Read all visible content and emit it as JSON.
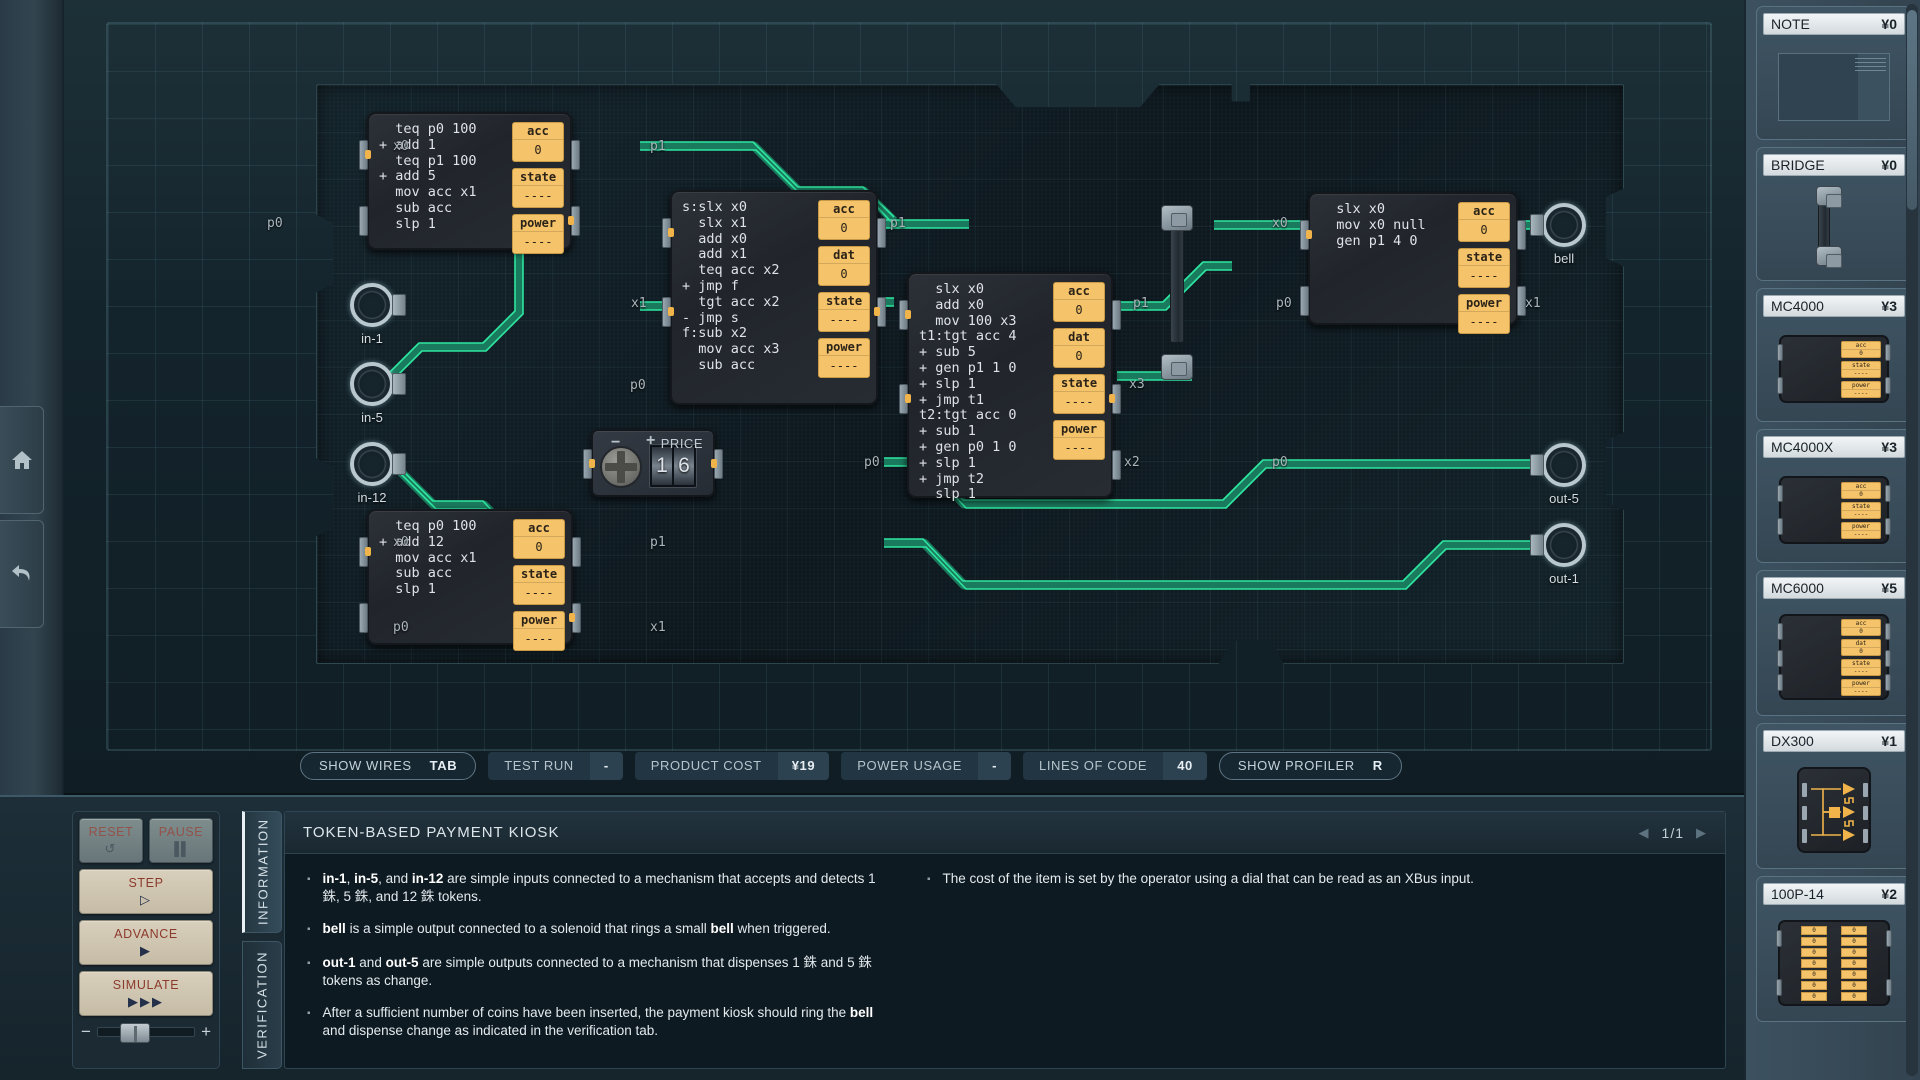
{
  "toolbar": {
    "show_wires": {
      "label": "SHOW WIRES",
      "key": "TAB"
    },
    "test_run": {
      "label": "TEST RUN",
      "value": "-"
    },
    "product_cost": {
      "label": "PRODUCT COST",
      "value": "¥19"
    },
    "power_usage": {
      "label": "POWER USAGE",
      "value": "-"
    },
    "lines_of_code": {
      "label": "LINES OF CODE",
      "value": "40"
    },
    "show_profiler": {
      "label": "SHOW PROFILER",
      "key": "R"
    }
  },
  "sim": {
    "reset": {
      "label": "RESET",
      "glyph": "↺"
    },
    "pause": {
      "label": "PAUSE",
      "glyph": "▐▌"
    },
    "step": {
      "label": "STEP",
      "glyph": "▷"
    },
    "advance": {
      "label": "ADVANCE",
      "glyph": "▶"
    },
    "simulate": {
      "label": "SIMULATE",
      "glyph": "▶▶▶"
    },
    "speed_minus": "−",
    "speed_plus": "+"
  },
  "tabs": [
    {
      "label": "INFORMATION",
      "selected": true
    },
    {
      "label": "VERIFICATION",
      "selected": false
    }
  ],
  "info": {
    "title": "TOKEN-BASED PAYMENT KIOSK",
    "page": "1/1",
    "prev_arrow": "◀",
    "next_arrow": "▶",
    "left_bullets": [
      "in-1, in-5, and in-12 are simple inputs connected to a mechanism that accepts and detects 1 銖, 5 銖, and 12 銖 tokens.",
      "bell is a simple output connected to a solenoid that rings a small bell when triggered.",
      "out-1 and out-5 are simple outputs connected to a mechanism that dispenses 1 銖 and 5 銖 tokens as change.",
      "After a sufficient number of coins have been inserted, the payment kiosk should ring the bell and dispense change as indicated in the verification tab."
    ],
    "right_bullets": [
      "The cost of the item is set by the operator using a dial that can be read as an XBus input."
    ]
  },
  "parts": [
    {
      "name": "NOTE",
      "cost": "¥0",
      "art": "note"
    },
    {
      "name": "BRIDGE",
      "cost": "¥0",
      "art": "bridge"
    },
    {
      "name": "MC4000",
      "cost": "¥3",
      "art": "mc4000"
    },
    {
      "name": "MC4000X",
      "cost": "¥3",
      "art": "mc4000x"
    },
    {
      "name": "MC6000",
      "cost": "¥5",
      "art": "mc6000"
    },
    {
      "name": "DX300",
      "cost": "¥1",
      "art": "dx300"
    },
    {
      "name": "100P-14",
      "cost": "¥2",
      "art": "100p14"
    }
  ],
  "board": {
    "chips": [
      {
        "id": "chip-top-left",
        "code": "  teq p0 100\n+ add 1\n  teq p1 100\n+ add 5\n  mov acc x1\n  sub acc\n  slp 1",
        "registers": [
          {
            "name": "acc",
            "value": "0"
          },
          {
            "name": "state",
            "value": "----"
          },
          {
            "name": "power",
            "value": "----"
          }
        ]
      },
      {
        "id": "chip-mid-left",
        "code": "s:slx x0\n  slx x1\n  add x0\n  add x1\n  teq acc x2\n+ jmp f\n  tgt acc x2\n- jmp s\nf:sub x2\n  mov acc x3\n  sub acc",
        "registers": [
          {
            "name": "acc",
            "value": "0"
          },
          {
            "name": "dat",
            "value": "0"
          },
          {
            "name": "state",
            "value": "----"
          },
          {
            "name": "power",
            "value": "----"
          }
        ]
      },
      {
        "id": "chip-center",
        "code": "  slx x0\n  add x0\n  mov 100 x3\nt1:tgt acc 4\n+ sub 5\n+ gen p1 1 0\n+ slp 1\n+ jmp t1\nt2:tgt acc 0\n+ sub 1\n+ gen p0 1 0\n+ slp 1\n+ jmp t2\n  slp 1",
        "registers": [
          {
            "name": "acc",
            "value": "0"
          },
          {
            "name": "dat",
            "value": "0"
          },
          {
            "name": "state",
            "value": "----"
          },
          {
            "name": "power",
            "value": "----"
          }
        ]
      },
      {
        "id": "chip-top-right",
        "code": "  slx x0\n  mov x0 null\n  gen p1 4 0",
        "registers": [
          {
            "name": "acc",
            "value": "0"
          },
          {
            "name": "state",
            "value": "----"
          },
          {
            "name": "power",
            "value": "----"
          }
        ]
      },
      {
        "id": "chip-bottom-left",
        "code": "  teq p0 100\n+ add 12\n  mov acc x1\n  sub acc\n  slp 1",
        "registers": [
          {
            "name": "acc",
            "value": "0"
          },
          {
            "name": "state",
            "value": "----"
          },
          {
            "name": "power",
            "value": "----"
          }
        ]
      }
    ],
    "io_nodes": [
      {
        "label": "in-1",
        "side": "left"
      },
      {
        "label": "in-5",
        "side": "left"
      },
      {
        "label": "in-12",
        "side": "left"
      },
      {
        "label": "bell",
        "side": "right"
      },
      {
        "label": "out-5",
        "side": "right"
      },
      {
        "label": "out-1",
        "side": "right"
      }
    ],
    "port_labels": [
      "x0",
      "p1",
      "p0",
      "x1",
      "p0",
      "p1",
      "x1",
      "p0",
      "x0",
      "p0",
      "x1",
      "x3",
      "x2",
      "p0",
      "x0",
      "p1"
    ],
    "price_dial": {
      "label": "PRICE",
      "digits": [
        "1",
        "6"
      ],
      "minus": "−",
      "plus": "+"
    }
  }
}
